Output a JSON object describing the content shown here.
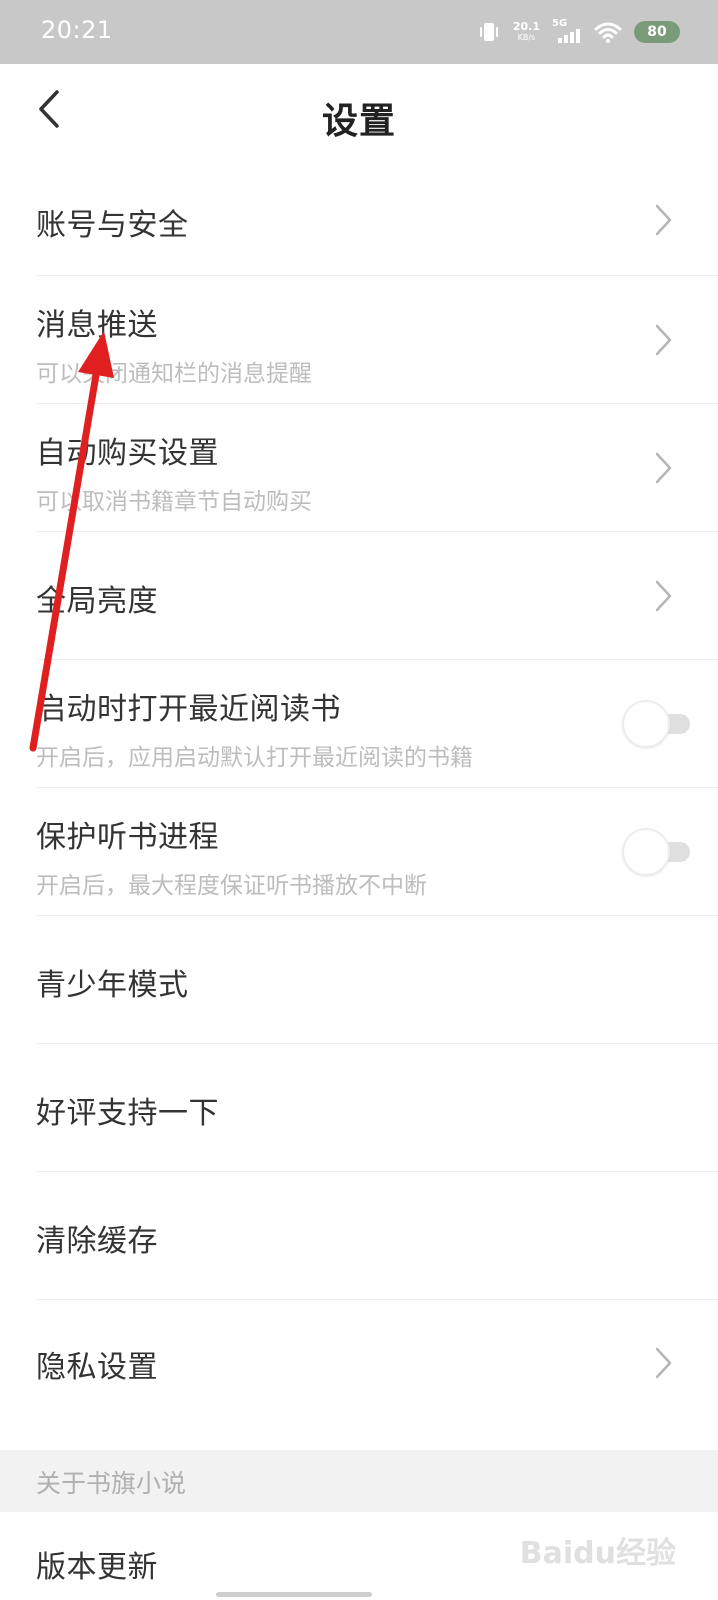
{
  "status_bar": {
    "time": "20:21",
    "net_speed_value": "20.1",
    "net_speed_unit": "KB/s",
    "network_type": "5G",
    "battery": "80"
  },
  "header": {
    "title": "设置"
  },
  "settings": [
    {
      "title": "账号与安全",
      "subtitle": "",
      "control": "chevron"
    },
    {
      "title": "消息推送",
      "subtitle": "可以关闭通知栏的消息提醒",
      "control": "chevron"
    },
    {
      "title": "自动购买设置",
      "subtitle": "可以取消书籍章节自动购买",
      "control": "chevron"
    },
    {
      "title": "全局亮度",
      "subtitle": "",
      "control": "chevron"
    },
    {
      "title": "启动时打开最近阅读书",
      "subtitle": "开启后，应用启动默认打开最近阅读的书籍",
      "control": "toggle",
      "on": false
    },
    {
      "title": "保护听书进程",
      "subtitle": "开启后，最大程度保证听书播放不中断",
      "control": "toggle",
      "on": false
    },
    {
      "title": "青少年模式",
      "subtitle": "",
      "control": "none"
    },
    {
      "title": "好评支持一下",
      "subtitle": "",
      "control": "none"
    },
    {
      "title": "清除缓存",
      "subtitle": "",
      "control": "none"
    },
    {
      "title": "隐私设置",
      "subtitle": "",
      "control": "chevron"
    }
  ],
  "about_section": {
    "header": "关于书旗小说",
    "items": [
      {
        "title": "版本更新"
      }
    ]
  },
  "watermark": "Baidu经验",
  "colors": {
    "annotation_arrow": "#e02020",
    "status_bar_bg": "#c8c8c8",
    "battery_bg": "#7a9b78"
  }
}
